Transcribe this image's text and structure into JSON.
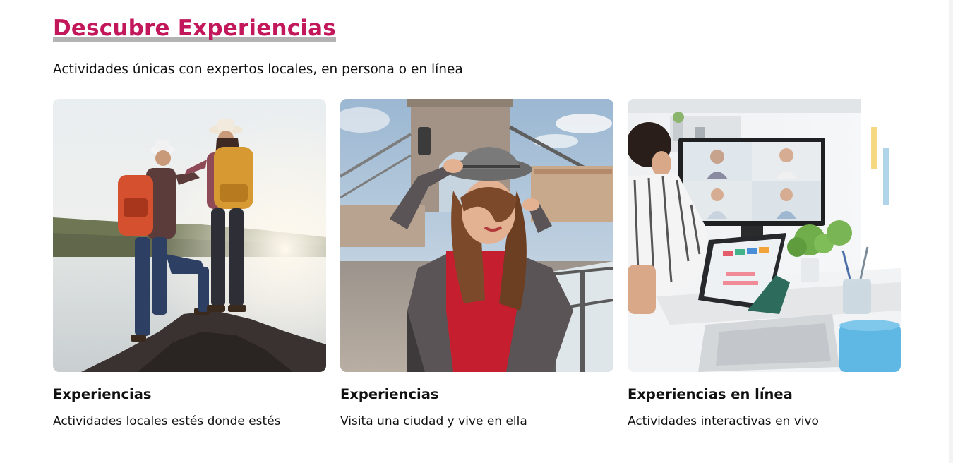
{
  "section": {
    "title": "Descubre Experiencias",
    "subtitle": "Actividades únicas con expertos locales, en persona o en línea"
  },
  "cards": [
    {
      "title": "Experiencias",
      "description": "Actividades locales estés donde estés",
      "image": "hikers-on-rock-by-lake-photo"
    },
    {
      "title": "Experiencias",
      "description": "Visita una ciudad y vive en ella",
      "image": "woman-in-hat-on-bridge-photo"
    },
    {
      "title": "Experiencias en línea",
      "description": "Actividades interactivas en vivo",
      "image": "video-call-office-desk-photo"
    }
  ],
  "colors": {
    "title": "#c2185b",
    "title_underline": "#b3b3b3",
    "text": "#111111",
    "background": "#ffffff"
  }
}
